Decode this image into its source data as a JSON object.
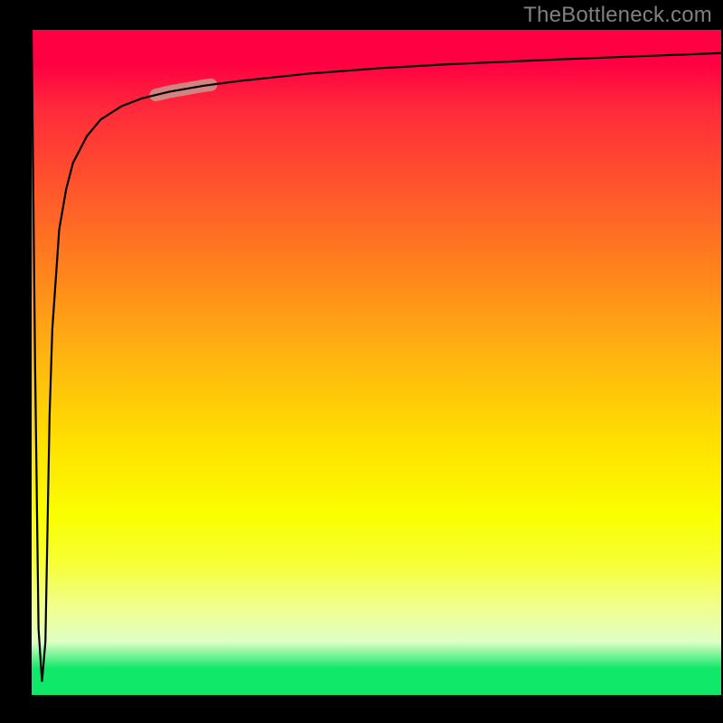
{
  "attribution": "TheBottleneck.com",
  "chart_data": {
    "type": "line",
    "title": "",
    "xlabel": "",
    "ylabel": "",
    "xlim": [
      0,
      100
    ],
    "ylim": [
      0,
      100
    ],
    "series": [
      {
        "name": "curve",
        "x": [
          0,
          0.5,
          1.0,
          1.5,
          2.0,
          2.3,
          2.6,
          3.0,
          4.0,
          5.0,
          6.0,
          8.0,
          10,
          13,
          16,
          20,
          25,
          30,
          40,
          50,
          60,
          75,
          90,
          100
        ],
        "y": [
          100,
          50,
          10,
          2,
          8,
          25,
          42,
          55,
          70,
          76,
          80,
          84,
          86.5,
          88.5,
          89.7,
          90.7,
          91.6,
          92.3,
          93.4,
          94.2,
          94.8,
          95.5,
          96.1,
          96.5
        ]
      }
    ],
    "highlight": {
      "x_range": [
        18,
        26
      ],
      "stroke_width": 14,
      "color": "#cf8f87"
    },
    "background_gradient": {
      "top": "#ff0042",
      "mid1": "#ff8a1a",
      "mid2": "#faff00",
      "bottom": "#10e86a"
    }
  }
}
